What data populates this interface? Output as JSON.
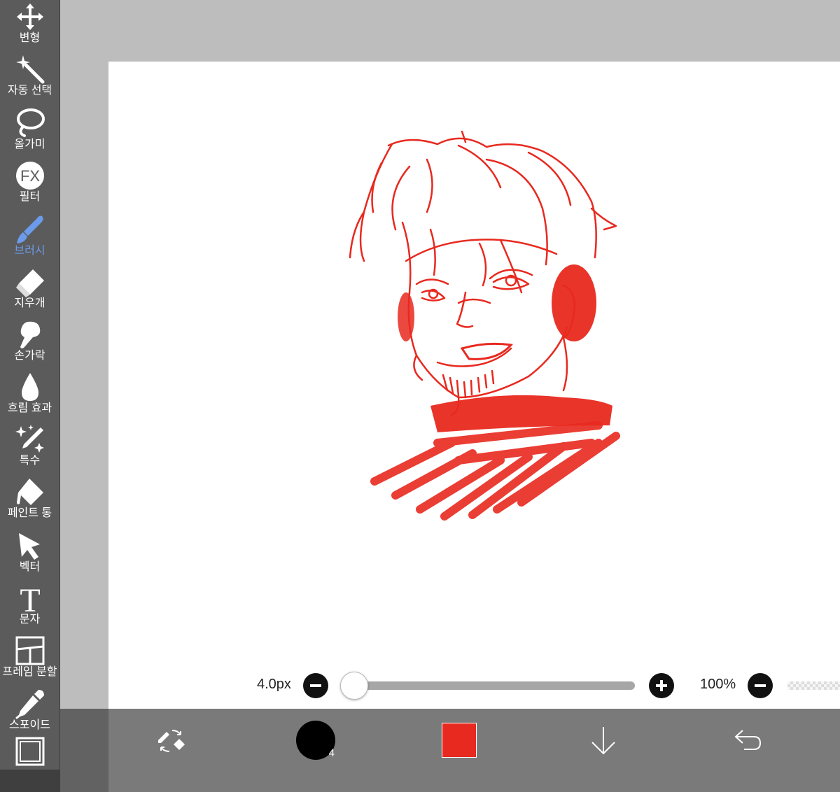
{
  "toolbar": {
    "tools": [
      {
        "label": "변형",
        "icon": "move-arrows-icon"
      },
      {
        "label": "자동 선택",
        "icon": "magic-wand-icon"
      },
      {
        "label": "올가미",
        "icon": "lasso-icon"
      },
      {
        "label": "필터",
        "icon": "fx-filter-icon"
      },
      {
        "label": "브러시",
        "icon": "brush-icon",
        "active": true
      },
      {
        "label": "지우개",
        "icon": "eraser-icon"
      },
      {
        "label": "손가락",
        "icon": "smudge-finger-icon"
      },
      {
        "label": "흐림 효과",
        "icon": "blur-drop-icon"
      },
      {
        "label": "특수",
        "icon": "special-sparkle-pen-icon"
      },
      {
        "label": "페인트 통",
        "icon": "paint-bucket-icon"
      },
      {
        "label": "벡터",
        "icon": "vector-cursor-icon"
      },
      {
        "label": "문자",
        "icon": "text-t-icon"
      },
      {
        "label": "프레임 분할",
        "icon": "frame-split-icon"
      },
      {
        "label": "스포이드",
        "icon": "eyedropper-icon"
      }
    ],
    "active_color": "#6b9bea"
  },
  "brush_controls": {
    "size_label": "4.0px",
    "size_fraction": 0.02,
    "opacity_label": "100%"
  },
  "bottom_bar": {
    "brush_size_number": "4",
    "current_color": "#e8291f"
  },
  "canvas": {
    "stroke_color": "#e8291f",
    "background": "#ffffff"
  }
}
